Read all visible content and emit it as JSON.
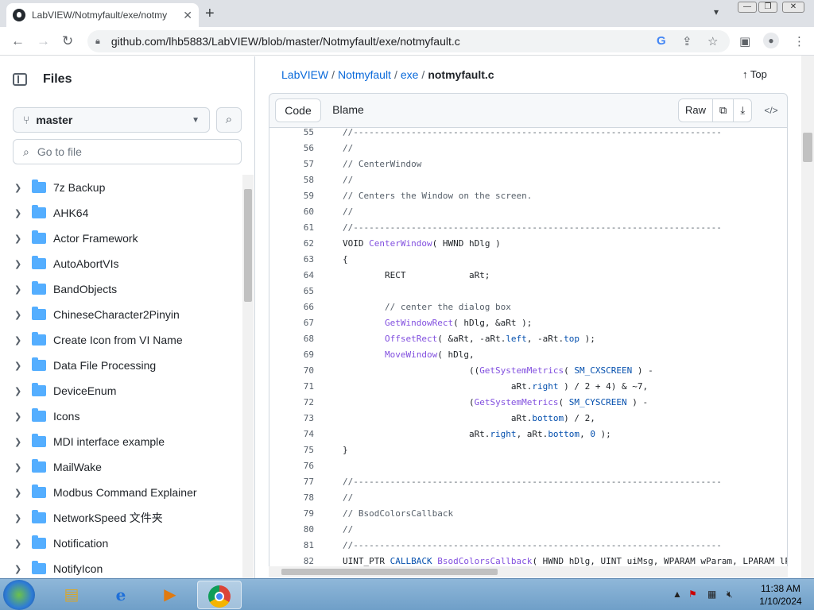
{
  "browser": {
    "tab_title": "LabVIEW/Notmyfault/exe/notmy",
    "tab_close": "✕",
    "new_tab": "+",
    "url": "github.com/lhb5883/LabVIEW/blob/master/Notmyfault/exe/notmyfault.c",
    "icons": [
      "back-icon",
      "forward-icon",
      "reload-icon",
      "lock-icon",
      "google-icon",
      "share-icon",
      "bookmark-icon",
      "sidepanel-icon",
      "profile-icon",
      "menu-icon"
    ]
  },
  "sidebar": {
    "title": "Files",
    "branch": "master",
    "goto_placeholder": "Go to file",
    "items": [
      "7z Backup",
      "AHK64",
      "Actor Framework",
      "AutoAbortVIs",
      "BandObjects",
      "ChineseCharacter2Pinyin",
      "Create Icon from VI Name",
      "Data File Processing",
      "DeviceEnum",
      "Icons",
      "MDI interface example",
      "MailWake",
      "Modbus Command Explainer",
      "NetworkSpeed 文件夹",
      "Notification",
      "NotifyIcon"
    ]
  },
  "breadcrumb": {
    "repo": "LabVIEW",
    "dir1": "Notmyfault",
    "dir2": "exe",
    "file": "notmyfault.c",
    "top": "Top"
  },
  "codebar": {
    "code": "Code",
    "blame": "Blame",
    "raw": "Raw"
  },
  "code_lines": [
    {
      "n": "55",
      "t": "//----------------------------------------------------------------------"
    },
    {
      "n": "56",
      "t": "//"
    },
    {
      "n": "57",
      "t": "// CenterWindow"
    },
    {
      "n": "58",
      "t": "//"
    },
    {
      "n": "59",
      "t": "// Centers the Window on the screen."
    },
    {
      "n": "60",
      "t": "//"
    },
    {
      "n": "61",
      "t": "//----------------------------------------------------------------------"
    },
    {
      "n": "62",
      "t": "VOID CenterWindow( HWND hDlg )"
    },
    {
      "n": "63",
      "t": "{"
    },
    {
      "n": "64",
      "t": "        RECT            aRt;"
    },
    {
      "n": "65",
      "t": ""
    },
    {
      "n": "66",
      "t": "        // center the dialog box"
    },
    {
      "n": "67",
      "t": "        GetWindowRect( hDlg, &aRt );"
    },
    {
      "n": "68",
      "t": "        OffsetRect( &aRt, -aRt.left, -aRt.top );"
    },
    {
      "n": "69",
      "t": "        MoveWindow( hDlg,"
    },
    {
      "n": "70",
      "t": "                        ((GetSystemMetrics( SM_CXSCREEN ) -"
    },
    {
      "n": "71",
      "t": "                                aRt.right ) / 2 + 4) & ~7,"
    },
    {
      "n": "72",
      "t": "                        (GetSystemMetrics( SM_CYSCREEN ) -"
    },
    {
      "n": "73",
      "t": "                                aRt.bottom) / 2,"
    },
    {
      "n": "74",
      "t": "                        aRt.right, aRt.bottom, 0 );"
    },
    {
      "n": "75",
      "t": "}"
    },
    {
      "n": "76",
      "t": ""
    },
    {
      "n": "77",
      "t": "//----------------------------------------------------------------------"
    },
    {
      "n": "78",
      "t": "//"
    },
    {
      "n": "79",
      "t": "// BsodColorsCallback"
    },
    {
      "n": "80",
      "t": "//"
    },
    {
      "n": "81",
      "t": "//----------------------------------------------------------------------"
    },
    {
      "n": "82",
      "t": "UINT_PTR CALLBACK BsodColorsCallback( HWND hDlg, UINT uiMsg, WPARAM wParam, LPARAM lP"
    }
  ],
  "taskbar": {
    "time": "11:38 AM",
    "date": "1/10/2024"
  }
}
